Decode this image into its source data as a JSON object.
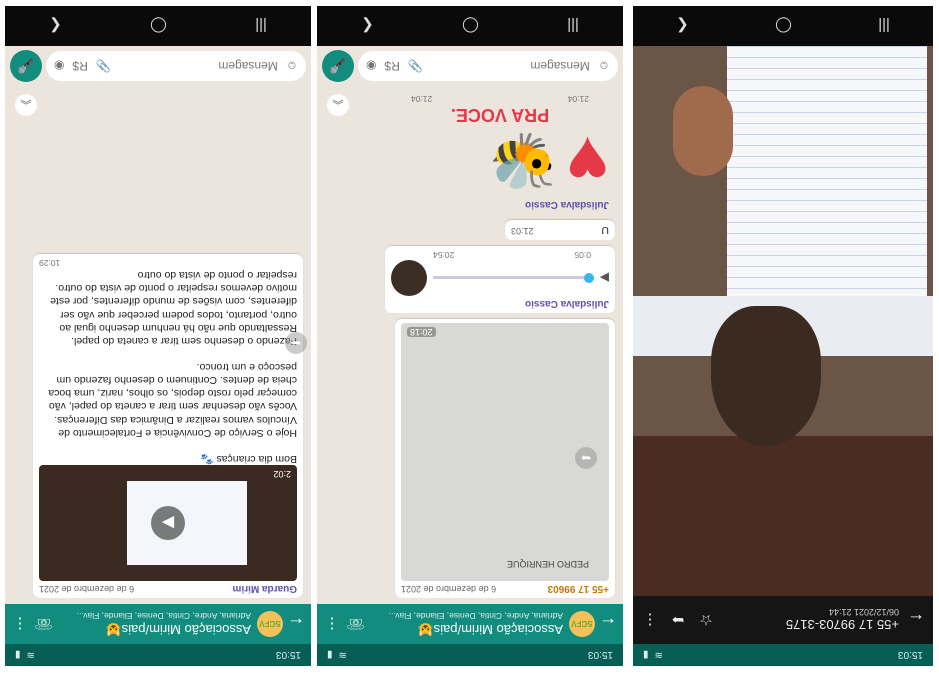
{
  "panel1": {
    "phone_number": "+55 17 99703-3175",
    "datetime": "06/12/2021 21:44",
    "status_time": "15:03"
  },
  "panel2": {
    "status_time": "15:03",
    "group_name": "Associação Mirim/pais😺",
    "group_members": "Adriana, Andre, Cintia, Denise, Eliande, Flav...",
    "msg1_sender": "+55 17 99603",
    "msg1_date": "6 de dezembro de 2021",
    "msg1_drawing_label": "PEDRO HENRIQUE",
    "msg1_time": "20:18",
    "msg2_sender": "Julisdalva Cassio",
    "msg2_duration": "0:05",
    "msg2_time": "20:54",
    "msg3_text": "U",
    "msg3_time": "21:03",
    "msg4_sender": "Julisdalva Cassio",
    "msg4_sticker_text": "PRA VOCE.",
    "msg4_time": "21:04",
    "msg5_time": "21:04",
    "input_placeholder": "Mensagem"
  },
  "panel3": {
    "status_time": "15:03",
    "group_name": "Associação Mirim/pais😺",
    "group_members": "Adriana, Andre, Cintia, Denise, Eliande, Flav...",
    "msg1_sender": "Guarda Mirim",
    "msg1_date": "6 de dezembro de 2021",
    "msg1_video_length": "2:02",
    "msg1_text": "Bom dia crianças 🐾\n\nHoje o Serviço de Convivência e Fortalecimento de Vínculos vamos realizar a Dinâmica das Diferenças.\nVocês vão desenhar sem tirar a caneta do papel, vão começar pelo rosto depois, os olhos, nariz, uma boca cheia de dentes. Continuem o desenho fazendo um pescoço e um tronco.\n\nFazendo o desenho sem tirar a caneta do papel.\nRessaltando que não há nenhum desenho igual ao outro, portanto, todos podem perceber que vão ser diferentes, com visões de mundo diferentes, por este motivo devemos respeitar o ponto de vista do outro.\nrespeitar o ponto de vista do outro",
    "msg1_time": "10:29",
    "input_placeholder": "Mensagem"
  }
}
